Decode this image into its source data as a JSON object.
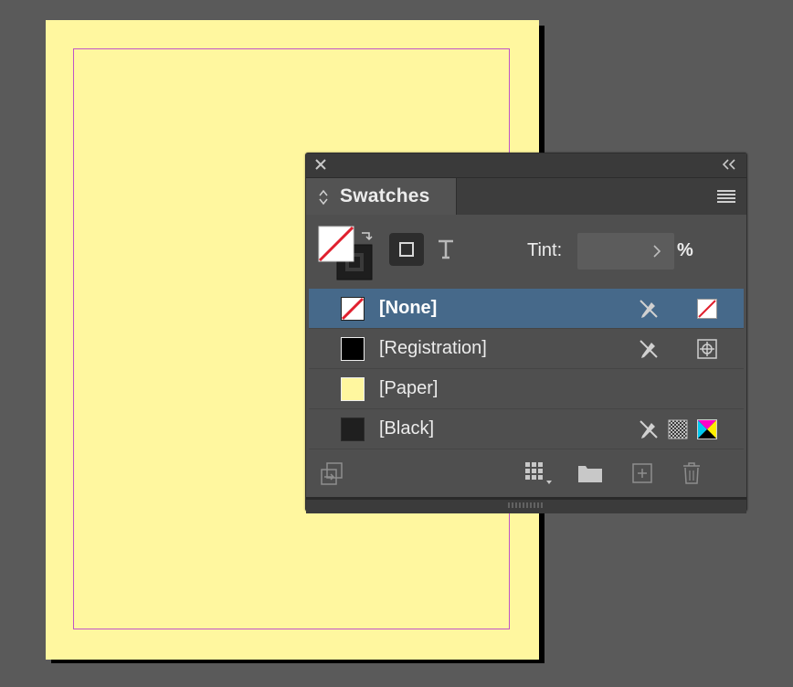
{
  "panel": {
    "title": "Swatches",
    "tint": {
      "label": "Tint:",
      "value": "",
      "unit": "%"
    }
  },
  "swatches": [
    {
      "name": "[None]",
      "color": "none",
      "selected": true
    },
    {
      "name": "[Registration]",
      "color": "#000000",
      "selected": false
    },
    {
      "name": "[Paper]",
      "color": "#fff79f",
      "selected": false
    },
    {
      "name": "[Black]",
      "color": "#1f1f1f",
      "selected": false
    }
  ],
  "icons": {
    "close": "close-icon",
    "collapse": "double-chevron-left-icon",
    "menu": "hamburger-menu-icon",
    "tab_toggle": "up-down-arrows-icon",
    "locked": "pencil-crossed-icon",
    "registration": "registration-target-icon",
    "process": "checkerboard-icon",
    "cmyk": "cmyk-icon",
    "none_swatch": "none-swatch-icon",
    "load": "load-swatches-icon",
    "swatch_views": "swatch-views-icon",
    "new_group": "folder-icon",
    "new_swatch": "new-swatch-icon",
    "delete": "trash-icon"
  },
  "colors": {
    "page": "#fff79f",
    "margin_guide": "#c054c8",
    "selection": "#46698a",
    "workspace": "#5a5a5a"
  }
}
